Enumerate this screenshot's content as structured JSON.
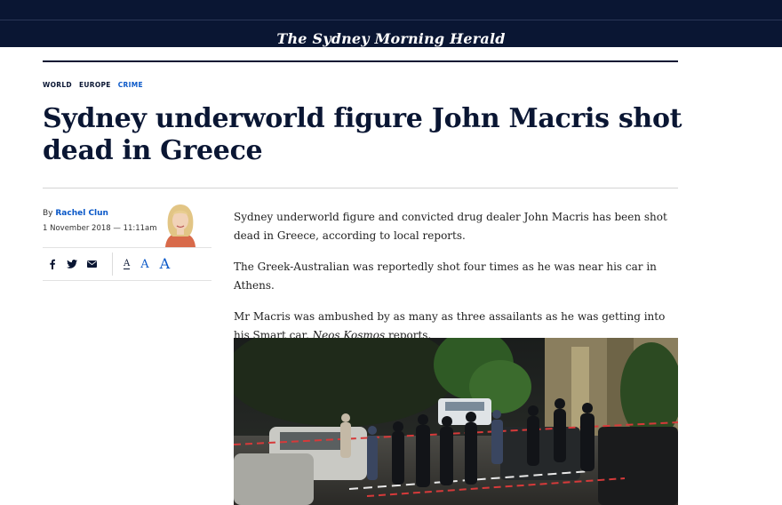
{
  "masthead": {
    "title": "The Sydney Morning Herald"
  },
  "breadcrumb": [
    {
      "label": "WORLD"
    },
    {
      "label": "EUROPE"
    },
    {
      "label": "CRIME"
    }
  ],
  "article": {
    "headline": "Sydney underworld figure John Macris shot dead in Greece",
    "byline_prefix": "By ",
    "author": "Rachel Clun",
    "date": "1 November 2018 — 11:11am",
    "paragraphs": [
      "Sydney underworld figure and convicted drug dealer John Macris has been shot dead in Greece, according to local reports.",
      "The Greek-Australian was reportedly shot four times as he was near his car in Athens."
    ],
    "p3_before": "Mr Macris was ambushed by as many as three assailants as he was getting into his Smart car, ",
    "p3_em": "Neos Kosmos",
    "p3_after": " reports."
  },
  "font_controls": {
    "small": "A",
    "medium": "A",
    "large": "A"
  },
  "share": {
    "facebook": "facebook-icon",
    "twitter": "twitter-icon",
    "email": "email-icon"
  },
  "colors": {
    "masthead": "#0a1633",
    "accent": "#0a58c8",
    "text": "#0a1633"
  }
}
